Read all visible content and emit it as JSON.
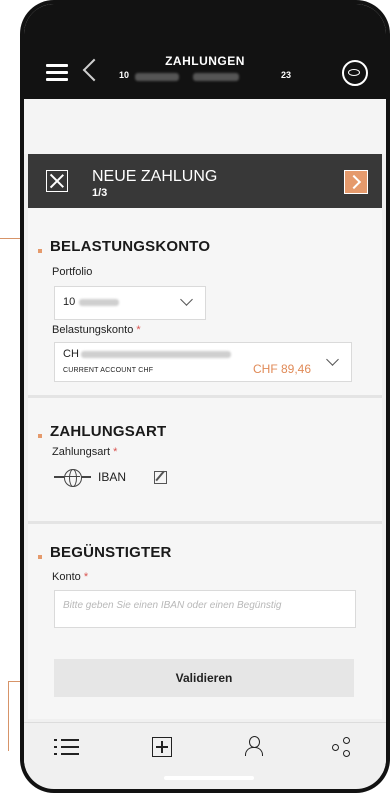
{
  "header": {
    "title": "ZAHLUNGEN",
    "subtitle_left": "10",
    "subtitle_right": "23"
  },
  "step": {
    "title": "NEUE ZAHLUNG",
    "count": "1/3"
  },
  "debit": {
    "section_title": "BELASTUNGSKONTO",
    "portfolio_label": "Portfolio",
    "portfolio_value": "10",
    "account_label": "Belastungskonto",
    "required_mark": "*",
    "account_prefix": "CH",
    "account_type": "CURRENT ACCOUNT CHF",
    "balance": "CHF 89,46"
  },
  "payment_type": {
    "section_title": "ZAHLUNGSART",
    "label": "Zahlungsart",
    "required_mark": "*",
    "value": "IBAN"
  },
  "beneficiary": {
    "section_title": "BEGÜNSTIGTER",
    "account_label": "Konto",
    "required_mark": "*",
    "placeholder": "Bitte geben Sie einen IBAN oder einen Begünstig"
  },
  "actions": {
    "validate": "Validieren"
  },
  "nav": {
    "items": [
      "list-icon",
      "add-icon",
      "contacts-icon",
      "share-icon"
    ]
  },
  "colors": {
    "accent": "#e59a6c",
    "header_bg": "#121212",
    "stepbar_bg": "#383838",
    "required": "#d9534f"
  }
}
